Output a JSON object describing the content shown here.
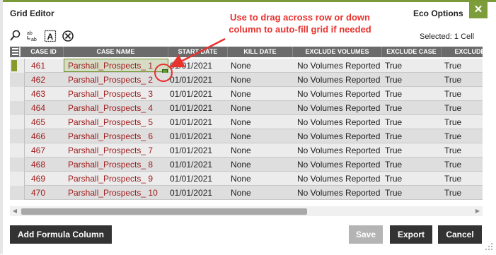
{
  "window": {
    "title": "Grid Editor",
    "menu": "Eco Options",
    "close_label": "✕",
    "accent_color": "#7d9d3a"
  },
  "toolbar": {
    "icons": [
      "search-icon",
      "find-replace-icon",
      "text-format-icon",
      "clear-icon"
    ],
    "selected_info": "Selected: 1 Cell"
  },
  "annotation": {
    "text_line1": "Use to drag across row or down",
    "text_line2": "column to auto-fill grid if needed",
    "color": "#e8322e"
  },
  "grid": {
    "columns": [
      "CASE ID",
      "CASE NAME",
      "START DATE",
      "KILL DATE",
      "EXCLUDE VOLUMES",
      "EXCLUDE CASE",
      "EXCLUDE C"
    ],
    "rows": [
      [
        "461",
        "Parshall_Prospects_ 1",
        "01/01/2021",
        "None",
        "No Volumes Reported",
        "True",
        "True"
      ],
      [
        "462",
        "Parshall_Prospects_ 2",
        "01/01/2021",
        "None",
        "No Volumes Reported",
        "True",
        "True"
      ],
      [
        "463",
        "Parshall_Prospects_ 3",
        "01/01/2021",
        "None",
        "No Volumes Reported",
        "True",
        "True"
      ],
      [
        "464",
        "Parshall_Prospects_ 4",
        "01/01/2021",
        "None",
        "No Volumes Reported",
        "True",
        "True"
      ],
      [
        "465",
        "Parshall_Prospects_ 5",
        "01/01/2021",
        "None",
        "No Volumes Reported",
        "True",
        "True"
      ],
      [
        "466",
        "Parshall_Prospects_ 6",
        "01/01/2021",
        "None",
        "No Volumes Reported",
        "True",
        "True"
      ],
      [
        "467",
        "Parshall_Prospects_ 7",
        "01/01/2021",
        "None",
        "No Volumes Reported",
        "True",
        "True"
      ],
      [
        "468",
        "Parshall_Prospects_ 8",
        "01/01/2021",
        "None",
        "No Volumes Reported",
        "True",
        "True"
      ],
      [
        "469",
        "Parshall_Prospects_ 9",
        "01/01/2021",
        "None",
        "No Volumes Reported",
        "True",
        "True"
      ],
      [
        "470",
        "Parshall_Prospects_ 10",
        "01/01/2021",
        "None",
        "No Volumes Reported",
        "True",
        "True"
      ]
    ]
  },
  "footer": {
    "add_formula_label": "Add Formula Column",
    "save_label": "Save",
    "export_label": "Export",
    "cancel_label": "Cancel"
  }
}
